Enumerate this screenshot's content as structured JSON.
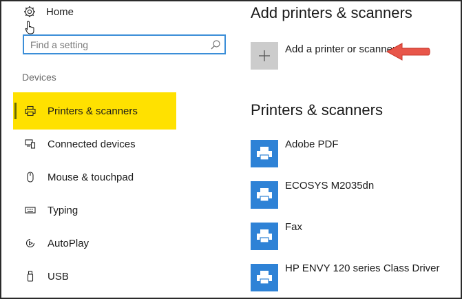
{
  "sidebar": {
    "home_label": "Home",
    "search": {
      "placeholder": "Find a setting"
    },
    "section_label": "Devices",
    "items": [
      {
        "label": "Printers & scanners",
        "icon": "printer-icon",
        "active": true
      },
      {
        "label": "Connected devices",
        "icon": "connected-devices-icon",
        "active": false
      },
      {
        "label": "Mouse & touchpad",
        "icon": "mouse-icon",
        "active": false
      },
      {
        "label": "Typing",
        "icon": "keyboard-icon",
        "active": false
      },
      {
        "label": "AutoPlay",
        "icon": "autoplay-icon",
        "active": false
      },
      {
        "label": "USB",
        "icon": "usb-icon",
        "active": false
      }
    ]
  },
  "main": {
    "add_section_title": "Add printers & scanners",
    "add_label": "Add a printer or scanner",
    "list_title": "Printers & scanners",
    "printers": [
      {
        "label": "Adobe PDF"
      },
      {
        "label": "ECOSYS M2035dn"
      },
      {
        "label": "Fax"
      },
      {
        "label": "HP ENVY 120 series Class Driver"
      }
    ]
  },
  "colors": {
    "active_highlight": "#ffe100",
    "search_border": "#3b8ed8",
    "printer_tile": "#2e82d6",
    "add_tile": "#cccccc",
    "arrow": "#e8564a"
  }
}
